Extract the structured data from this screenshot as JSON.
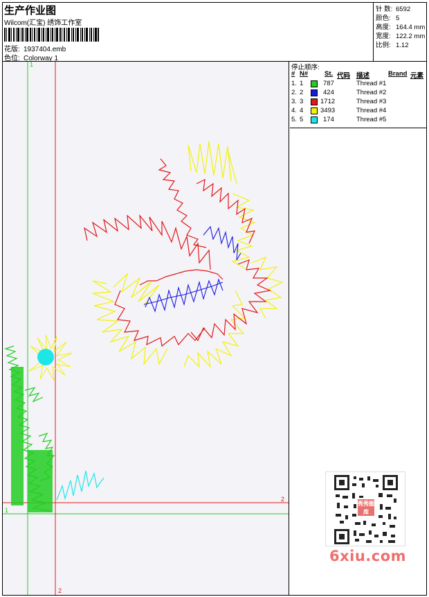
{
  "header": {
    "title": "生产作业图",
    "company": "Wilcom(汇宝) 绣饰工作室",
    "design_label": "花版:",
    "design_file": "1937404.emb",
    "colorway_label": "色位:",
    "colorway": "Colorway 1"
  },
  "stats": [
    {
      "label": "针 数:",
      "value": "6592"
    },
    {
      "label": "颜色:",
      "value": "5"
    },
    {
      "label": "高度:",
      "value": "164.4 mm"
    },
    {
      "label": "宽度:",
      "value": "122.2 mm"
    },
    {
      "label": "比例:",
      "value": "1.12"
    }
  ],
  "sequence": {
    "title": "停止顺序:",
    "headers": {
      "hash": "#",
      "n": "N#",
      "stitches": "St.",
      "code": "代码",
      "desc": "描述",
      "brand": "Brand",
      "element": "元素"
    },
    "rows": [
      {
        "index": "1.",
        "n": "1",
        "color": "#22cc22",
        "stitches": "787",
        "desc": "Thread #1"
      },
      {
        "index": "2.",
        "n": "2",
        "color": "#1a1adf",
        "stitches": "424",
        "desc": "Thread #2"
      },
      {
        "index": "3.",
        "n": "3",
        "color": "#e01818",
        "stitches": "1712",
        "desc": "Thread #3"
      },
      {
        "index": "4.",
        "n": "4",
        "color": "#f2f20a",
        "stitches": "3493",
        "desc": "Thread #4"
      },
      {
        "index": "5.",
        "n": "5",
        "color": "#1ee6e6",
        "stitches": "174",
        "desc": "Thread #5"
      }
    ]
  },
  "hoop_labels": {
    "green_top": "1",
    "green_left": "1",
    "red_right": "2",
    "red_bottom": "2"
  },
  "watermark": {
    "site": "6xiu.com",
    "seal": "秀秀图库"
  },
  "colors": {
    "green": "#22cc22",
    "blue": "#1a1adf",
    "red": "#e01818",
    "yellow": "#f2f20a",
    "cyan": "#1ee6e6"
  }
}
